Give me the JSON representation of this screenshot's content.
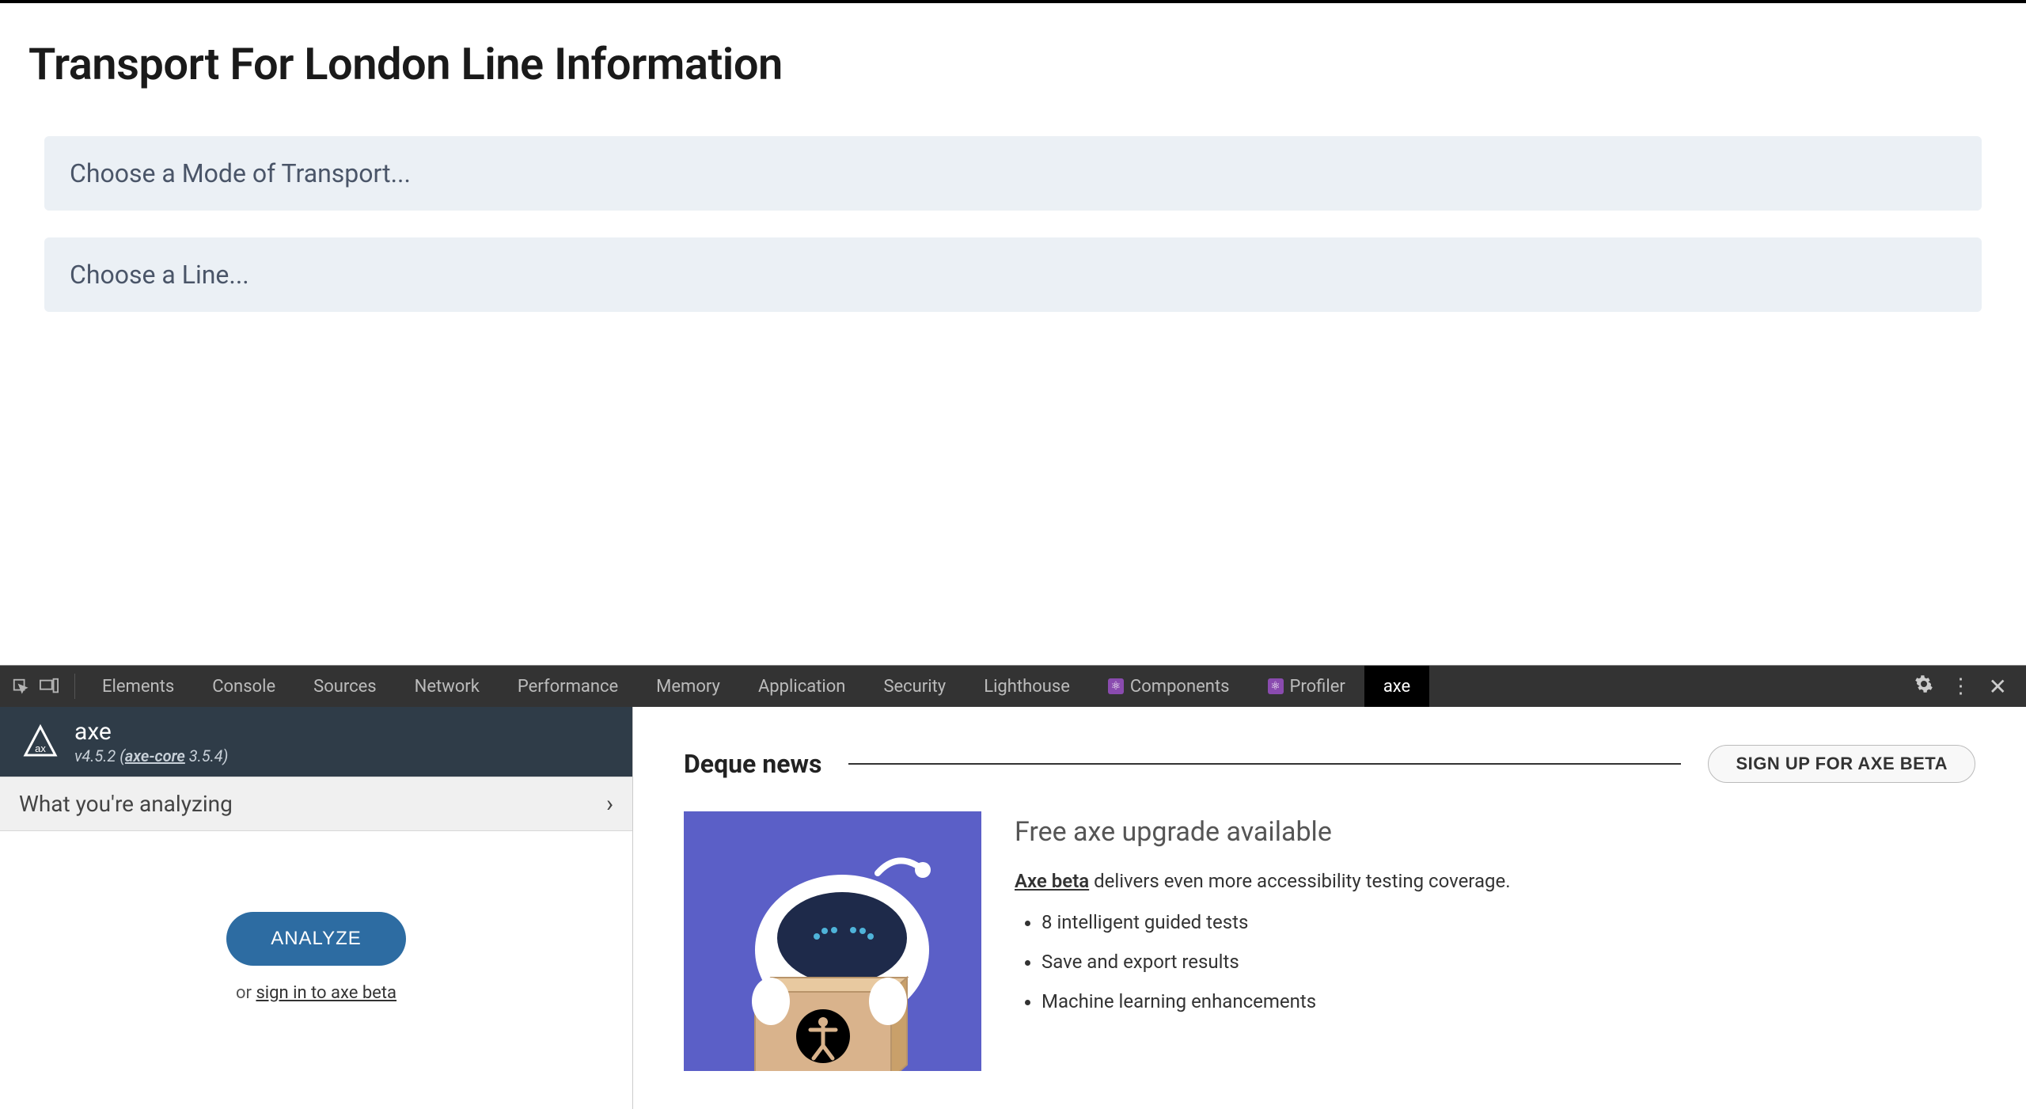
{
  "page": {
    "title": "Transport For London Line Information",
    "selects": [
      {
        "label": "Choose a Mode of Transport..."
      },
      {
        "label": "Choose a Line..."
      }
    ]
  },
  "devtools": {
    "tabs": [
      "Elements",
      "Console",
      "Sources",
      "Network",
      "Performance",
      "Memory",
      "Application",
      "Security",
      "Lighthouse"
    ],
    "react_tabs": [
      "Components",
      "Profiler"
    ],
    "active_tab": "axe"
  },
  "axe": {
    "name": "axe",
    "version_prefix": "v4.5.2 (",
    "core_label": "axe-core",
    "version_suffix": " 3.5.4)",
    "analyzing_label": "What you're analyzing",
    "analyze_btn": "ANALYZE",
    "signin_prefix": "or  ",
    "signin_link": "sign in to axe beta"
  },
  "news": {
    "header": "Deque news",
    "signup_btn": "SIGN UP FOR AXE BETA",
    "title": "Free axe upgrade available",
    "beta_link": "Axe beta",
    "subtitle_rest": " delivers even more accessibility testing coverage.",
    "bullets": [
      "8 intelligent guided tests",
      "Save and export results",
      "Machine learning enhancements"
    ]
  }
}
